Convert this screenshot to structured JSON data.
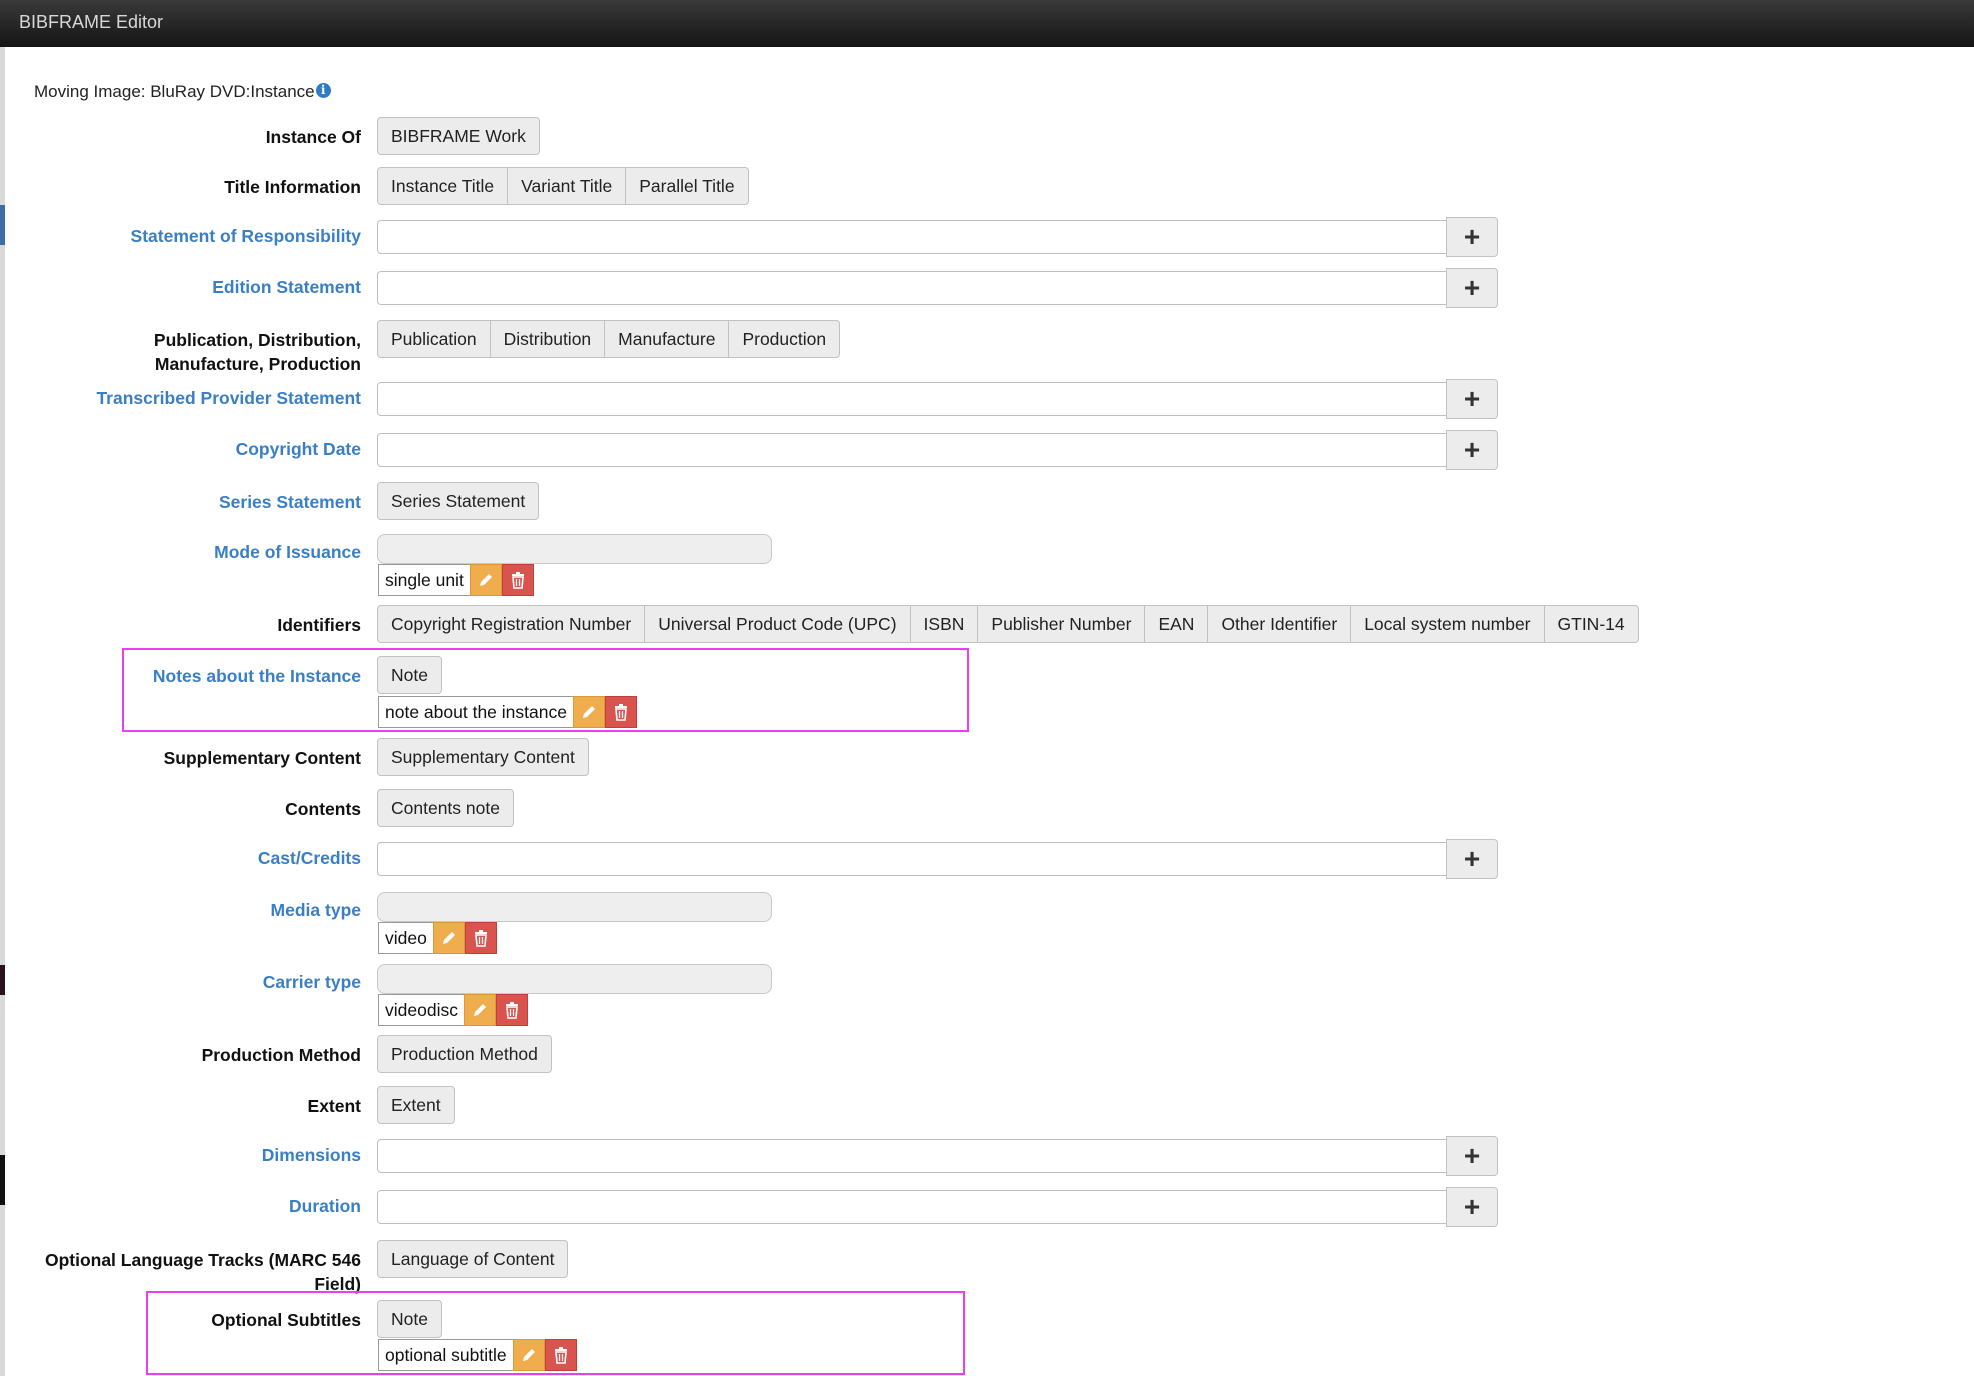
{
  "window": {
    "title": "BIBFRAME Editor"
  },
  "form": {
    "title": "Moving Image: BluRay DVD:Instance",
    "info_glyph": "i"
  },
  "rows": {
    "instance_of": {
      "label": "Instance Of",
      "buttons": [
        "BIBFRAME Work"
      ]
    },
    "title_information": {
      "label": "Title Information",
      "buttons": [
        "Instance Title",
        "Variant Title",
        "Parallel Title"
      ]
    },
    "statement_of_responsibility": {
      "label": "Statement of Responsibility",
      "value": "",
      "add": "+"
    },
    "edition_statement": {
      "label": "Edition Statement",
      "value": "",
      "add": "+"
    },
    "publication": {
      "label_line1": "Publication, Distribution,",
      "label_line2": "Manufacture, Production",
      "buttons": [
        "Publication",
        "Distribution",
        "Manufacture",
        "Production"
      ]
    },
    "transcribed_provider": {
      "label": "Transcribed Provider Statement",
      "value": "",
      "add": "+"
    },
    "copyright_date": {
      "label": "Copyright Date",
      "value": "",
      "add": "+"
    },
    "series_statement": {
      "label": "Series Statement",
      "buttons": [
        "Series Statement"
      ]
    },
    "mode_of_issuance": {
      "label": "Mode of Issuance",
      "lookup_value": "",
      "chip": "single unit"
    },
    "identifiers": {
      "label": "Identifiers",
      "buttons": [
        "Copyright Registration Number",
        "Universal Product Code (UPC)",
        "ISBN",
        "Publisher Number",
        "EAN",
        "Other Identifier",
        "Local system number",
        "GTIN-14"
      ]
    },
    "notes_about_instance": {
      "label": "Notes about the Instance",
      "buttons": [
        "Note"
      ],
      "chip": "note about the instance"
    },
    "supplementary_content": {
      "label": "Supplementary Content",
      "buttons": [
        "Supplementary Content"
      ]
    },
    "contents": {
      "label": "Contents",
      "buttons": [
        "Contents note"
      ]
    },
    "cast_credits": {
      "label": "Cast/Credits",
      "value": "",
      "add": "+"
    },
    "media_type": {
      "label": "Media type",
      "lookup_value": "",
      "chip": "video"
    },
    "carrier_type": {
      "label": "Carrier type",
      "lookup_value": "",
      "chip": "videodisc"
    },
    "production_method": {
      "label": "Production Method",
      "buttons": [
        "Production Method"
      ]
    },
    "extent": {
      "label": "Extent",
      "buttons": [
        "Extent"
      ]
    },
    "dimensions": {
      "label": "Dimensions",
      "value": "",
      "add": "+"
    },
    "duration": {
      "label": "Duration",
      "value": "",
      "add": "+"
    },
    "optional_language_tracks": {
      "label_line1": "Optional Language Tracks (MARC 546",
      "label_line2": "Field)",
      "buttons": [
        "Language of Content"
      ]
    },
    "optional_subtitles": {
      "label": "Optional Subtitles",
      "buttons": [
        "Note"
      ],
      "chip": "optional subtitle"
    }
  },
  "colors": {
    "link_label": "#3a7fc6",
    "edit": "#f0ad4e",
    "delete": "#d9534f",
    "highlight": "#e840f0"
  },
  "icons": {
    "add": "plus-icon",
    "edit": "pencil-icon",
    "delete": "trash-icon",
    "info": "info-icon"
  }
}
